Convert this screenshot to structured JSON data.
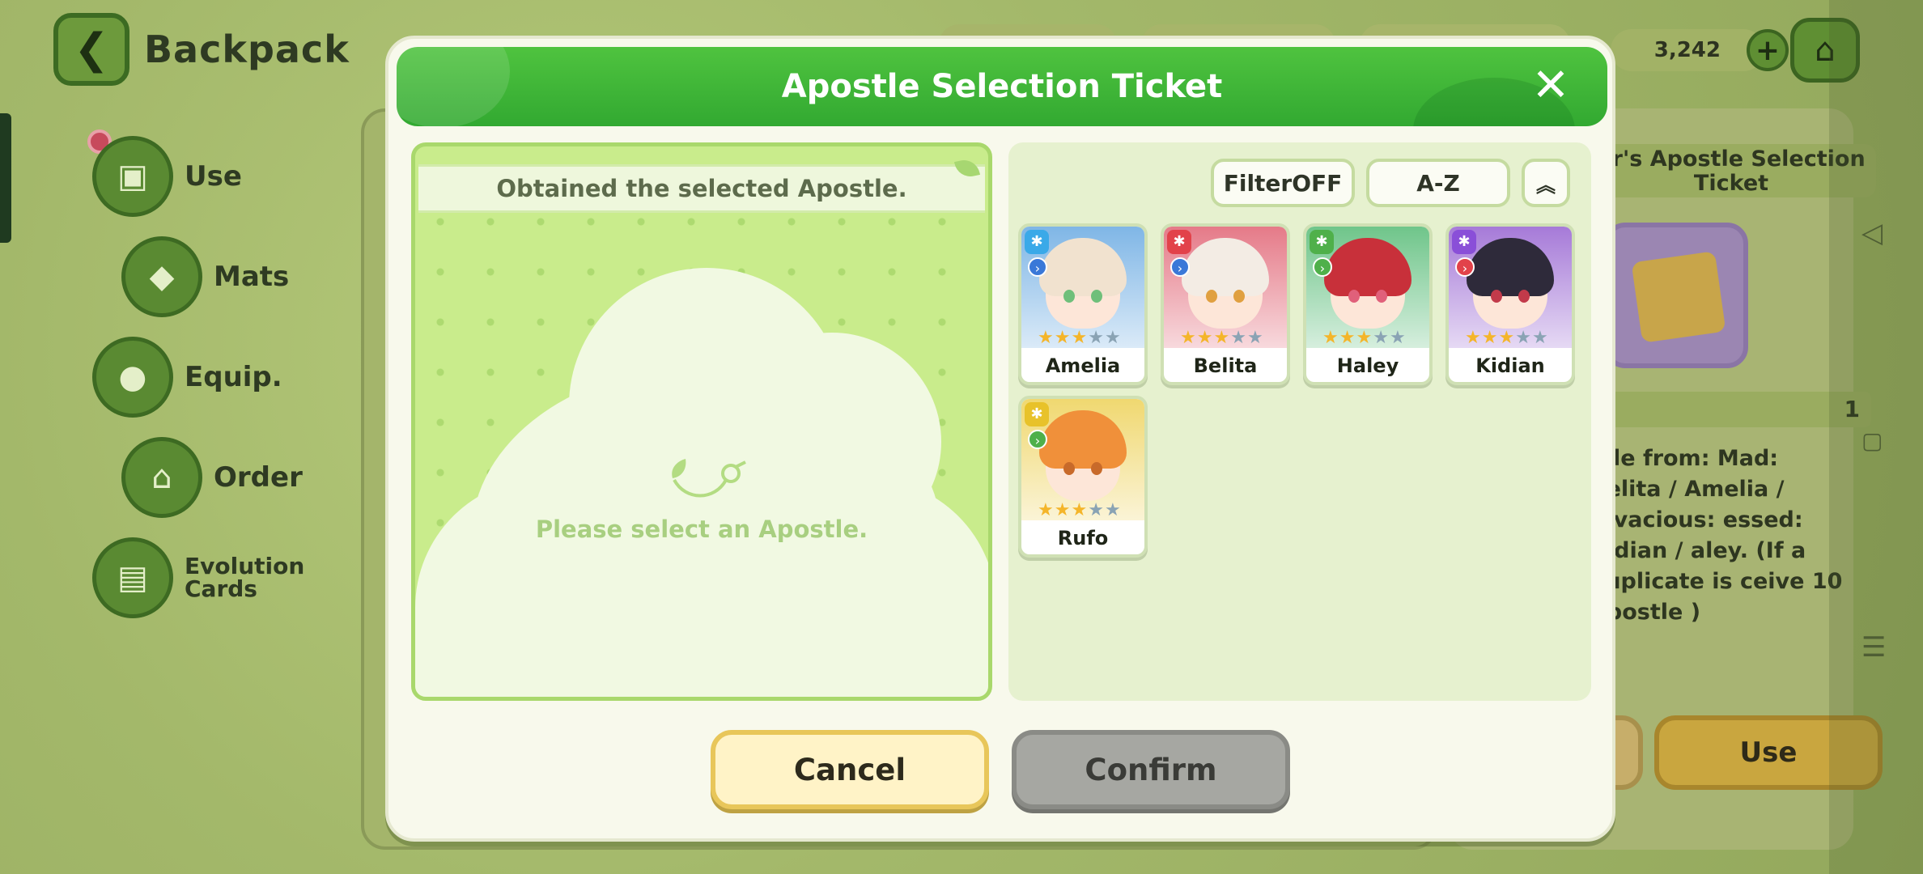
{
  "backpack": {
    "title": "Backpack",
    "menu": [
      {
        "label": "Use"
      },
      {
        "label": "Mats"
      },
      {
        "label": "Equip."
      },
      {
        "label": "Order"
      },
      {
        "label": "Evolution Cards"
      }
    ],
    "currency": "3,242",
    "detail": {
      "ticket_title_partial": "er's Apostle Selection Ticket",
      "count": "1",
      "description_partial": "stle from: Mad: Belita / Amelia / Vivacious: essed: Kidian / aley. (If a duplicate is ceive 10 Apostle )",
      "use_label": "Use"
    }
  },
  "modal": {
    "title": "Apostle Selection Ticket",
    "close_label": "✕",
    "preview": {
      "caption": "Obtained the selected Apostle.",
      "placeholder": "Please select an Apostle."
    },
    "toolbar": {
      "filter_label": "FilterOFF",
      "sort_label": "A-Z",
      "collapse_label": "︽"
    },
    "apostles": [
      {
        "name": "Amelia",
        "stars": 3,
        "max_stars": 5,
        "element_color": "#3aa9e8",
        "class_color": "#3a78d8",
        "bg": "#7fb6e6",
        "hair": "#f1e2cf",
        "eye": "#6fbf7a"
      },
      {
        "name": "Belita",
        "stars": 3,
        "max_stars": 5,
        "element_color": "#e2424a",
        "class_color": "#3a78d8",
        "bg": "#e57a88",
        "hair": "#f3ece4",
        "eye": "#e0a040"
      },
      {
        "name": "Haley",
        "stars": 3,
        "max_stars": 5,
        "element_color": "#4fb04a",
        "class_color": "#4fb04a",
        "bg": "#6fc58a",
        "hair": "#c8303a",
        "eye": "#e0607a"
      },
      {
        "name": "Kidian",
        "stars": 3,
        "max_stars": 5,
        "element_color": "#8a4fd8",
        "class_color": "#e2424a",
        "bg": "#a67ad8",
        "hair": "#2e2a3a",
        "eye": "#c23a4a"
      },
      {
        "name": "Rufo",
        "stars": 3,
        "max_stars": 5,
        "element_color": "#e8c22a",
        "class_color": "#4fb04a",
        "bg": "#f0d870",
        "hair": "#f0903a",
        "eye": "#c86a2a"
      }
    ],
    "cancel_label": "Cancel",
    "confirm_label": "Confirm"
  }
}
